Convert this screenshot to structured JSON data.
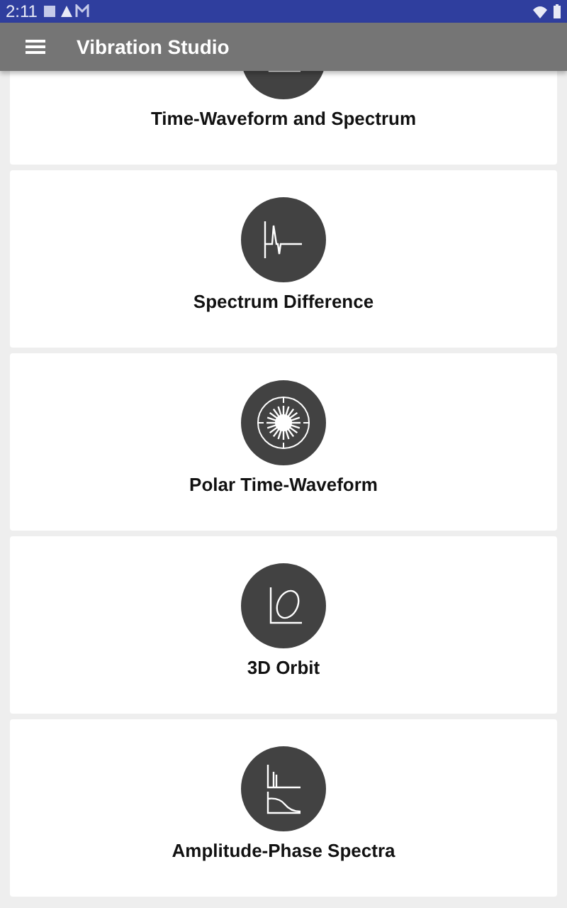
{
  "status_bar": {
    "time": "2:11"
  },
  "app_bar": {
    "title": "Vibration Studio"
  },
  "cards": [
    {
      "kind": "time-spectrum",
      "label": "Time-Waveform and Spectrum"
    },
    {
      "kind": "spectrum-difference",
      "label": "Spectrum Difference"
    },
    {
      "kind": "polar",
      "label": "Polar Time-Waveform"
    },
    {
      "kind": "orbit",
      "label": "3D Orbit"
    },
    {
      "kind": "amplitude-phase",
      "label": "Amplitude-Phase Spectra"
    }
  ]
}
